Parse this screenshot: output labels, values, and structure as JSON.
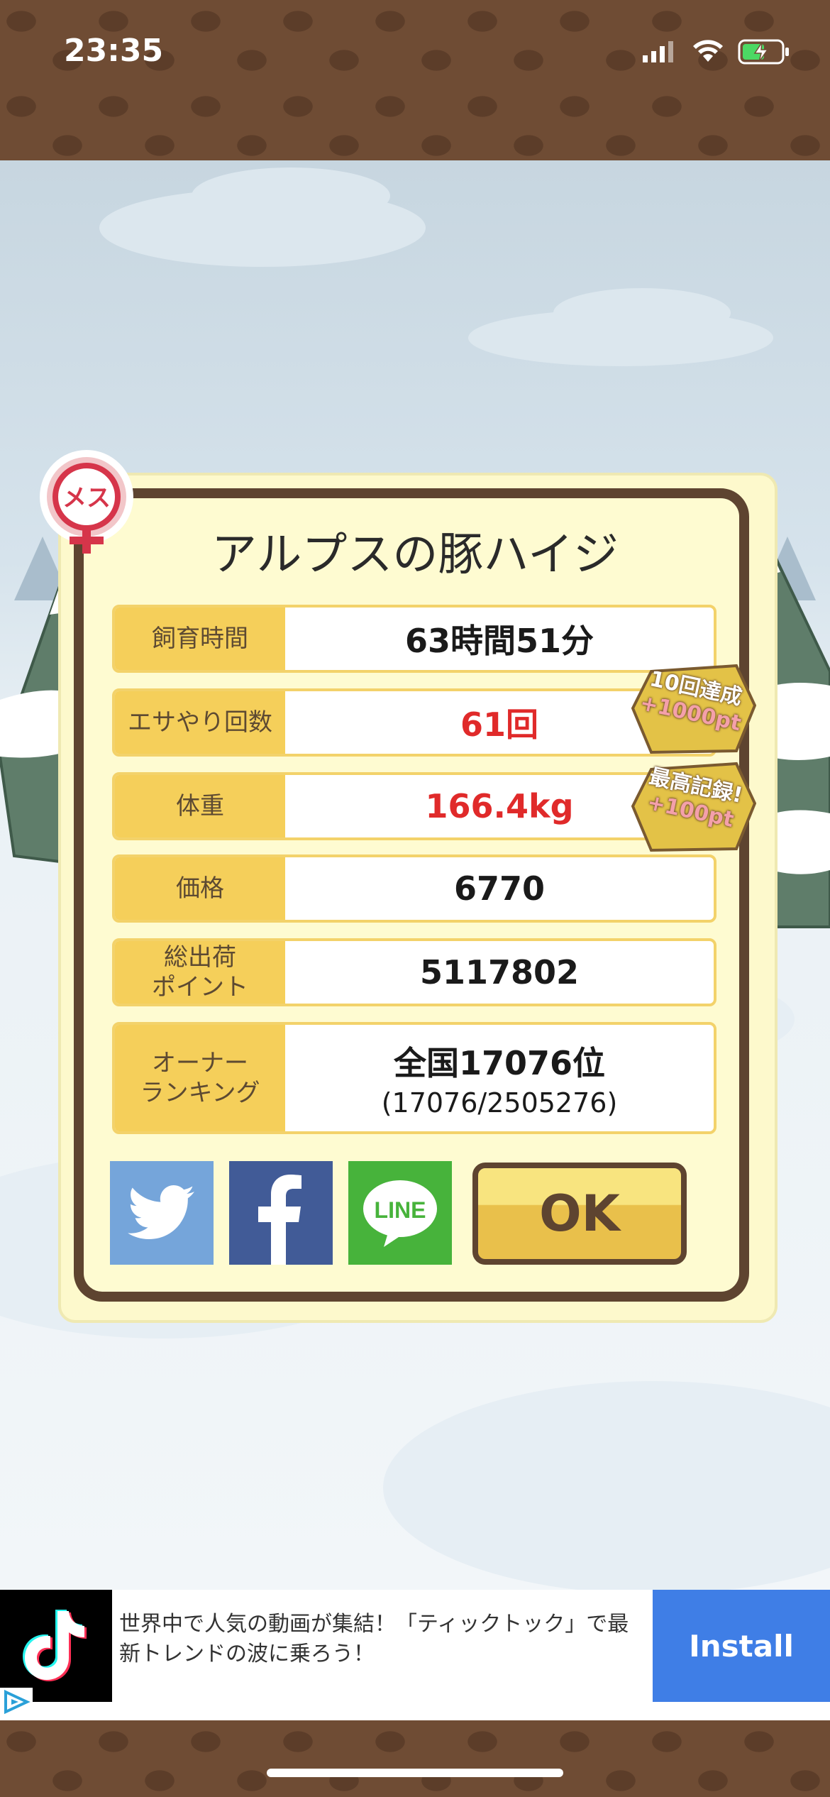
{
  "status_bar": {
    "time": "23:35"
  },
  "dialog": {
    "gender_badge": "メス",
    "title": "アルプスの豚ハイジ",
    "rows": [
      {
        "label": "飼育時間",
        "value": "63時間51分"
      },
      {
        "label": "エサやり回数",
        "value": "61回"
      },
      {
        "label": "体重",
        "value": "166.4kg"
      },
      {
        "label": "価格",
        "value": "6770"
      },
      {
        "label": "総出荷\nポイント",
        "value": "5117802"
      },
      {
        "label": "オーナー\nランキング",
        "value": "全国17076位",
        "sub": "(17076/2505276)"
      }
    ],
    "awards": [
      {
        "line1": "10回達成",
        "line2": "+1000pt"
      },
      {
        "line1": "最高記録!",
        "line2": "+100pt"
      }
    ],
    "social": {
      "twitter": "twitter",
      "facebook": "f",
      "line": "LINE"
    },
    "ok_label": "OK"
  },
  "ad": {
    "text": "世界中で人気の動画が集結！「ティックトック」で最新トレンドの波に乗ろう！",
    "install_label": "Install"
  },
  "colors": {
    "label_bg": "#f5cf5a",
    "highlight_red": "#e02a2a",
    "frame_brown": "#5e4430",
    "install_blue": "#3f7ee6"
  }
}
